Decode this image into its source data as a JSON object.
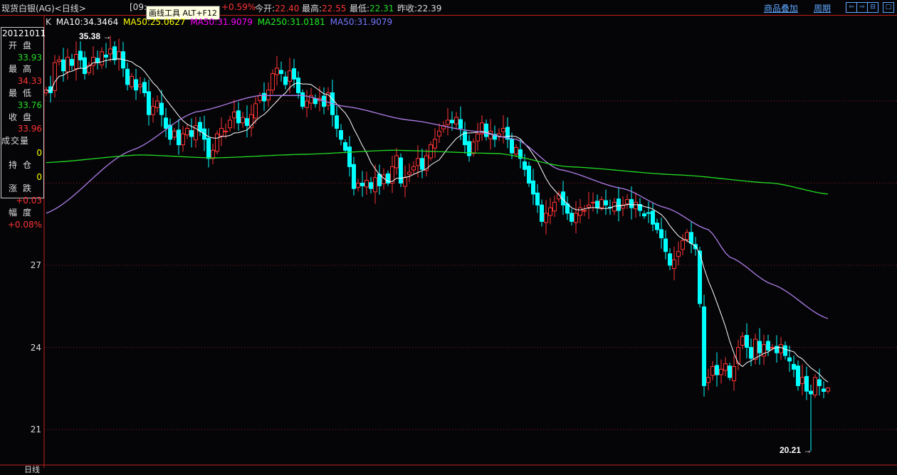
{
  "header": {
    "title": "现货白银(AG)<日线>",
    "time_partial": "[09:",
    "change_pct": "+0.59%",
    "open_label": "今开:",
    "open": "22.40",
    "high_label": "最高:",
    "high": "22.55",
    "low_label": "最低:",
    "low": "22.31",
    "prev_label": "昨收:",
    "prev": "22.39",
    "overlay_link": "商品叠加",
    "period_link": "周期",
    "icons": [
      "arrow-left-icon",
      "arrow-right-icon",
      "split-panel-icon",
      "maximize-icon"
    ]
  },
  "tooltip": "画线工具 ALT+F12",
  "legend": {
    "k": "K",
    "ma10": "MA10:34.3464",
    "ma50a": "MA50:25.0627",
    "ma50b": "MA50:31.9079",
    "ma250": "MA250:31.0181",
    "ma50c": "MA50:31.9079"
  },
  "info": {
    "date": "20121011",
    "open_label": "开盘",
    "open": "33.93",
    "high_label": "最高",
    "high": "34.33",
    "low_label": "最低",
    "low": "33.76",
    "close_label": "收盘",
    "close": "33.96",
    "vol_label": "成交量",
    "vol": "0",
    "oi_label": "持仓",
    "oi": "0",
    "chg_label": "涨跌",
    "chg": "+0.03",
    "pct_label": "幅度",
    "pct": "+0.08%"
  },
  "footer": {
    "label": "日线"
  },
  "colors": {
    "up": "#ff3333",
    "down": "#00ffff",
    "ma10": "#ffffff",
    "ma50": "#b07ee8",
    "ma250": "#22dd22",
    "grid": "#8a1a1a"
  },
  "chart_data": {
    "type": "candlestick",
    "y_ticks": [
      21,
      24,
      27,
      30,
      33
    ],
    "y_tick_labels": [
      "21",
      "24",
      "27"
    ],
    "ylim": [
      19.6,
      36.2
    ],
    "max_annotation": {
      "index": 15,
      "label": "35.38"
    },
    "min_annotation": {
      "index": 179,
      "label": "20.21"
    },
    "closes": [
      33.4,
      33.3,
      34.4,
      34.5,
      34.1,
      34.6,
      34.3,
      34.7,
      34.5,
      34.0,
      34.3,
      34.6,
      34.4,
      34.8,
      34.6,
      34.9,
      34.5,
      34.8,
      34.2,
      33.6,
      33.9,
      33.4,
      33.6,
      33.3,
      32.5,
      32.8,
      33.0,
      32.5,
      32.0,
      31.6,
      31.9,
      31.4,
      31.8,
      32.0,
      31.7,
      32.1,
      31.9,
      31.6,
      30.9,
      31.2,
      31.8,
      32.0,
      31.9,
      32.3,
      32.6,
      32.2,
      32.4,
      32.1,
      32.5,
      32.9,
      33.2,
      33.0,
      33.4,
      34.0,
      34.2,
      34.0,
      33.6,
      34.1,
      33.8,
      33.3,
      32.8,
      33.0,
      33.2,
      32.9,
      33.1,
      32.8,
      33.3,
      32.5,
      32.0,
      31.6,
      31.2,
      30.6,
      29.8,
      30.0,
      29.9,
      30.1,
      29.8,
      30.2,
      29.9,
      30.3,
      30.0,
      30.6,
      31.0,
      30.0,
      30.2,
      30.4,
      30.6,
      30.9,
      30.5,
      31.0,
      31.4,
      31.6,
      31.9,
      32.1,
      32.3,
      32.2,
      32.4,
      32.0,
      31.4,
      31.0,
      31.5,
      31.8,
      32.2,
      31.7,
      31.9,
      31.6,
      31.8,
      32.0,
      31.6,
      31.1,
      31.3,
      30.9,
      30.5,
      30.0,
      29.6,
      29.2,
      28.6,
      28.9,
      29.1,
      29.3,
      29.6,
      29.2,
      28.9,
      28.6,
      28.9,
      29.1,
      29.0,
      29.2,
      29.3,
      29.1,
      29.4,
      29.2,
      29.1,
      29.3,
      29.0,
      29.2,
      29.4,
      29.1,
      29.3,
      29.0,
      28.8,
      28.9,
      28.5,
      28.3,
      28.0,
      27.5,
      27.0,
      27.2,
      27.5,
      27.9,
      28.2,
      27.8,
      27.6,
      25.6,
      22.6,
      22.9,
      23.3,
      23.0,
      23.2,
      23.4,
      22.9,
      23.3,
      24.0,
      24.4,
      24.0,
      23.6,
      24.3,
      23.8,
      24.1,
      23.9,
      24.0,
      23.8,
      24.1,
      23.7,
      23.5,
      23.2,
      22.6,
      22.9,
      22.4,
      22.3,
      22.9,
      22.6,
      22.39,
      22.52
    ],
    "last_candle": {
      "open": 22.4,
      "high": 22.55,
      "low": 22.31,
      "close": 22.52
    },
    "ma50_points": [
      [
        0,
        28.9
      ],
      [
        20,
        31.2
      ],
      [
        35,
        32.6
      ],
      [
        50,
        33.2
      ],
      [
        60,
        33.2
      ],
      [
        70,
        32.8
      ],
      [
        85,
        32.3
      ],
      [
        100,
        31.9
      ],
      [
        110,
        31.6
      ],
      [
        120,
        30.5
      ],
      [
        135,
        29.8
      ],
      [
        145,
        29.1
      ],
      [
        155,
        28.3
      ],
      [
        160,
        27.3
      ],
      [
        170,
        26.3
      ],
      [
        183,
        25.05
      ]
    ],
    "ma250_points": [
      [
        0,
        30.75
      ],
      [
        22,
        31.03
      ],
      [
        39,
        30.92
      ],
      [
        60,
        31.05
      ],
      [
        81,
        31.2
      ],
      [
        106,
        31.08
      ],
      [
        122,
        30.6
      ],
      [
        148,
        30.3
      ],
      [
        170,
        30.0
      ],
      [
        183,
        29.6
      ]
    ]
  }
}
